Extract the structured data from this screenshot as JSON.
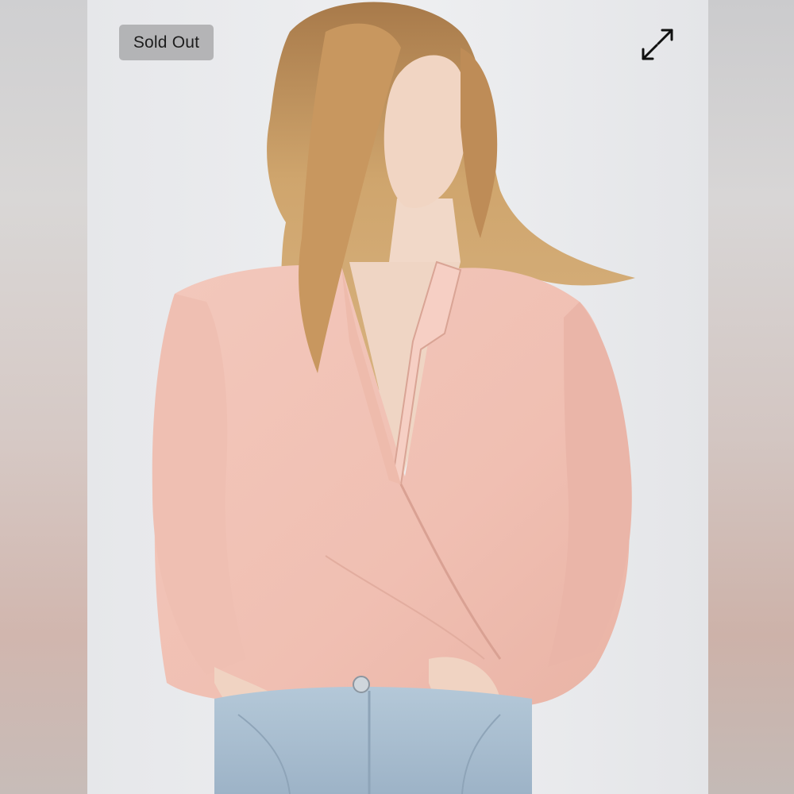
{
  "product_image": {
    "badge_label": "Sold Out",
    "expand_icon": "expand-arrows-icon",
    "photo_subject": "model-pink-wrap-blouse",
    "colors": {
      "background": "#e9eaec",
      "blouse": "#f2c3b7",
      "hair": "#c99a63",
      "denim": "#a9bfd2",
      "badge_bg": "#afafb1"
    }
  }
}
